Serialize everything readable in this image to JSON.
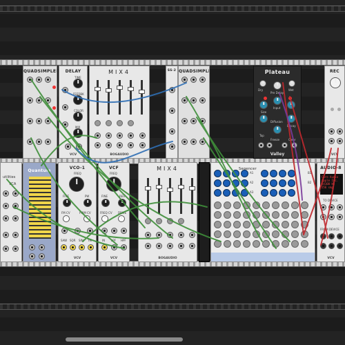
{
  "modules_row1": {
    "quadsampler_left": {
      "title": "QUADSIMPLER"
    },
    "delay": {
      "title": "DELAY",
      "footer": "VCV",
      "labels": [
        "TIME",
        "FEEDBK",
        "COLOR",
        "MIX"
      ]
    },
    "mix4_top": {
      "title": "MIX4",
      "footer": "BOGAUDIO"
    },
    "ss2": {
      "title": "SS-2"
    },
    "quadsampler_right": {
      "title": "QUADSIMPLER"
    },
    "plateau": {
      "title": "Plateau",
      "subtitle": "Valley",
      "labels": [
        "Dry",
        "Wet",
        "Pre Delay",
        "Input",
        "Size",
        "Diffusion",
        "Decay",
        "Tap",
        "Freeze",
        "Clear"
      ]
    },
    "rec": {
      "title": "REC",
      "footer": "VCV"
    }
  },
  "modules_row2": {
    "utilities": {
      "labels": [
        "utilities",
        "VCA"
      ]
    },
    "quantum": {
      "title": "Quantum"
    },
    "vco1": {
      "title": "VCO-1",
      "footer": "VCV",
      "labels": [
        "FREQ",
        "FINE",
        "PW",
        "FM CV",
        "PWM CV",
        "SAW",
        "SQR",
        "SIN",
        "TRI"
      ]
    },
    "vcf": {
      "title": "VCF",
      "footer": "VCV",
      "labels": [
        "FREQ",
        "FINE",
        "RES",
        "DRIVE",
        "FREQ CV",
        "IN",
        "LPF",
        "HPF"
      ]
    },
    "mix4_bottom": {
      "title": "MIX4",
      "footer": "BOGAUDIO"
    },
    "sequencer": {
      "title": "Seqencer",
      "labels": [
        "A1",
        "A2",
        "A3",
        "B1",
        "B2"
      ]
    },
    "audio8": {
      "title": "AUDIO-8",
      "footer": "VCV",
      "screen": [
        "Core Audio",
        "Apple Inc.",
        "44100 Hz",
        "256 smp"
      ],
      "labels": [
        "TO DEVICE",
        "FROM DEVICE"
      ]
    }
  },
  "colors": {
    "cable_green": "#3f8f3a",
    "cable_blue": "#2f6fb5",
    "cable_red": "#c0282d",
    "cable_purple": "#7a3a9a",
    "led_red": "#e33",
    "led_green": "#3c3",
    "knob_blue": "#1a5fb8"
  },
  "icons": [
    "jack-icon",
    "knob-icon",
    "fader-icon",
    "led-icon",
    "cable-icon"
  ]
}
